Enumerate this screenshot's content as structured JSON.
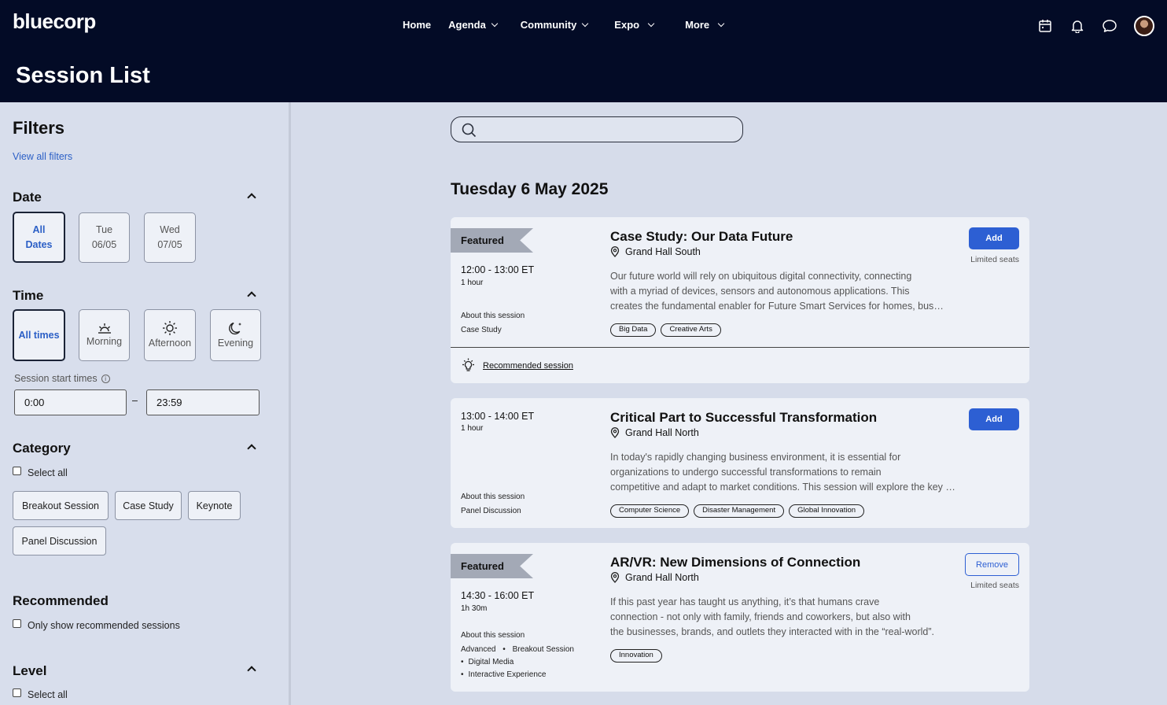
{
  "header": {
    "logo_text": "bluecorp",
    "nav": [
      {
        "label": "Home",
        "dropdown": false
      },
      {
        "label": "Agenda",
        "dropdown": true
      },
      {
        "label": "Community",
        "dropdown": true
      },
      {
        "label": "Expo",
        "dropdown": true
      },
      {
        "label": "More",
        "dropdown": true
      }
    ],
    "icons": [
      "calendar-icon",
      "bell-icon",
      "chat-icon",
      "avatar"
    ],
    "page_title": "Session List"
  },
  "sidebar": {
    "title": "Filters",
    "view_all": "View all filters",
    "date": {
      "title": "Date",
      "options": [
        {
          "line1": "All",
          "line2": "Dates",
          "selected": true
        },
        {
          "line1": "Tue",
          "line2": "06/05",
          "selected": false
        },
        {
          "line1": "Wed",
          "line2": "07/05",
          "selected": false
        }
      ]
    },
    "time": {
      "title": "Time",
      "options": [
        {
          "label": "All times",
          "icon": "",
          "selected": true
        },
        {
          "label": "Morning",
          "icon": "sunrise-icon",
          "selected": false
        },
        {
          "label": "Afternoon",
          "icon": "sun-icon",
          "selected": false
        },
        {
          "label": "Evening",
          "icon": "moon-icon",
          "selected": false
        }
      ],
      "start_label": "Session start times",
      "from": "0:00",
      "dash": "–",
      "to": "23:59"
    },
    "category": {
      "title": "Category",
      "select_all": "Select all",
      "chips": [
        "Breakout Session",
        "Case Study",
        "Keynote",
        "Panel Discussion"
      ]
    },
    "recommended": {
      "title": "Recommended",
      "checkbox": "Only show recommended sessions"
    },
    "level": {
      "title": "Level",
      "select_all": "Select all"
    }
  },
  "main": {
    "search_placeholder": "",
    "date_heading": "Tuesday 6 May 2025",
    "sessions": [
      {
        "featured": "Featured",
        "time": "12:00 - 13:00 ET",
        "duration": "1 hour",
        "about": "About this session",
        "type": "Case Study",
        "title": "Case Study: Our Data Future",
        "location": "Grand Hall South",
        "desc": [
          "Our future world will rely on ubiquitous digital connectivity, connecting",
          "with a myriad of devices, sensors and autonomous applications. This",
          "creates the fundamental enabler for Future Smart Services for homes, businesses and cities."
        ],
        "tags": [
          "Big Data",
          "Creative Arts"
        ],
        "button": "Add",
        "limited": "Limited seats",
        "recommended": "Recommended session"
      },
      {
        "time": "13:00 - 14:00 ET",
        "duration": "1 hour",
        "about": "About this session",
        "type": "Panel Discussion",
        "title": "Critical Part to Successful Transformation",
        "location": "Grand Hall North",
        "desc": [
          "In today's rapidly changing business environment, it is essential for",
          "organizations to undergo successful transformations to remain",
          "competitive and adapt to market conditions. This session will explore the key elements."
        ],
        "tags": [
          "Computer Science",
          "Disaster Management",
          "Global Innovation"
        ],
        "button": "Add"
      },
      {
        "featured": "Featured",
        "time": "14:30 - 16:00 ET",
        "duration": "1h 30m",
        "about": "About this session",
        "meta1": "Advanced",
        "meta2": "Breakout Session",
        "meta3": "Digital Media",
        "meta4": "Interactive Experience",
        "title": "AR/VR: New Dimensions of Connection",
        "location": "Grand Hall North",
        "desc": [
          "If this past year has taught us anything, it’s that humans crave",
          "connection - not only with family, friends and coworkers, but also with",
          "the businesses, brands, and outlets they interacted with in the “real-world”."
        ],
        "tags": [
          "Innovation"
        ],
        "button": "Remove",
        "limited": "Limited seats"
      }
    ]
  }
}
